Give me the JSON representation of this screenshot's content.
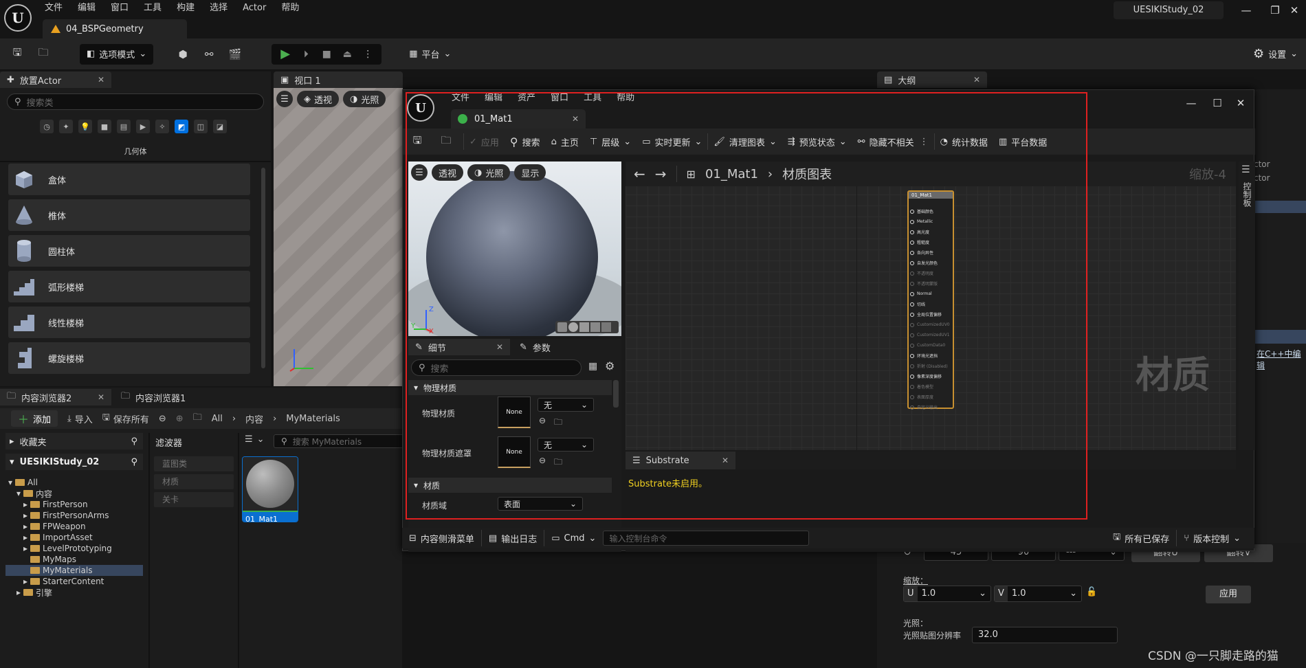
{
  "main_menu": [
    "文件",
    "编辑",
    "窗口",
    "工具",
    "构建",
    "选择",
    "Actor",
    "帮助"
  ],
  "level_tab": "04_BSPGeometry",
  "project_name": "UESIKIStudy_02",
  "toolbar": {
    "mode_label": "选项模式",
    "platform_label": "平台",
    "settings_label": "设置"
  },
  "place_actor": {
    "tab": "放置Actor",
    "search_placeholder": "搜索类",
    "category_label": "几何体",
    "items": [
      "盒体",
      "椎体",
      "圆柱体",
      "弧形楼梯",
      "线性楼梯",
      "螺旋楼梯"
    ]
  },
  "viewport": {
    "tab": "视口 1",
    "perspective": "透视",
    "lighting": "光照"
  },
  "outliner": {
    "tab": "大纲"
  },
  "content_browser": {
    "tab1": "内容浏览器2",
    "tab2": "内容浏览器1",
    "add": "添加",
    "import": "导入",
    "save_all": "保存所有",
    "breadcrumb": [
      "All",
      "内容",
      "MyMaterials"
    ],
    "favorites": "收藏夹",
    "project": "UESIKIStudy_02",
    "tree": [
      {
        "label": "All",
        "depth": 0
      },
      {
        "label": "内容",
        "depth": 1
      },
      {
        "label": "FirstPerson",
        "depth": 2
      },
      {
        "label": "FirstPersonArms",
        "depth": 2
      },
      {
        "label": "FPWeapon",
        "depth": 2
      },
      {
        "label": "ImportAsset",
        "depth": 2
      },
      {
        "label": "LevelPrototyping",
        "depth": 2
      },
      {
        "label": "MyMaps",
        "depth": 2
      },
      {
        "label": "MyMaterials",
        "depth": 2
      },
      {
        "label": "StarterContent",
        "depth": 2
      },
      {
        "label": "引擎",
        "depth": 1
      }
    ],
    "filters_title": "滤波器",
    "filters": [
      "蓝图类",
      "材质",
      "关卡"
    ],
    "search_placeholder": "搜索 MyMaterials",
    "asset": {
      "name": "01_Mat1",
      "type": "材质"
    }
  },
  "material_editor": {
    "menu": [
      "文件",
      "编辑",
      "资产",
      "窗口",
      "工具",
      "帮助"
    ],
    "tab": "01_Mat1",
    "toolbar": [
      "应用",
      "搜索",
      "主页",
      "层级",
      "实时更新",
      "清理图表",
      "预览状态",
      "隐藏不相关",
      "统计数据",
      "平台数据"
    ],
    "preview_buttons": [
      "透视",
      "光照",
      "显示"
    ],
    "graph": {
      "title": "01_Mat1",
      "crumb": "材质图表",
      "zoom": "缩放-4",
      "watermark": "材质",
      "side_tab": "控制板"
    },
    "node": {
      "title": "01_Mat1",
      "pins": [
        {
          "label": "基础颜色",
          "active": true
        },
        {
          "label": "Metallic",
          "active": true
        },
        {
          "label": "高光度",
          "active": true
        },
        {
          "label": "粗糙度",
          "active": true
        },
        {
          "label": "各向异性",
          "active": true
        },
        {
          "label": "自发光颜色",
          "active": true
        },
        {
          "label": "不透明度",
          "active": false
        },
        {
          "label": "不透明蒙版",
          "active": false
        },
        {
          "label": "Normal",
          "active": true
        },
        {
          "label": "切线",
          "active": true
        },
        {
          "label": "全局位置偏移",
          "active": true
        },
        {
          "label": "CustomizedUV0",
          "active": false
        },
        {
          "label": "CustomizedUV1",
          "active": false
        },
        {
          "label": "CustomData0",
          "active": false
        },
        {
          "label": "环境光遮挡",
          "active": true
        },
        {
          "label": "折射 (Disabled)",
          "active": false
        },
        {
          "label": "像素深度偏移",
          "active": true
        },
        {
          "label": "着色模型",
          "active": false
        },
        {
          "label": "表面厚度",
          "active": false
        },
        {
          "label": "自定义输出",
          "active": false
        }
      ]
    },
    "details": {
      "tab": "细节",
      "params_tab": "参数",
      "search_placeholder": "搜索",
      "section_physical": "物理材质",
      "physical_material": "物理材质",
      "physical_mask": "物理材质遮罩",
      "none": "None",
      "dropdown_none": "无",
      "section_material": "材质",
      "material_domain": "材质域",
      "material_domain_value": "表面"
    },
    "substrate": {
      "tab": "Substrate",
      "message": "Substrate未启用。"
    }
  },
  "statusbar": {
    "drawer": "内容侧滑菜单",
    "log": "输出日志",
    "cmd": "Cmd",
    "cmd_placeholder": "输入控制台命令",
    "saved": "所有已保存",
    "source_control": "版本控制"
  },
  "right_panel": {
    "rot1": "45",
    "rot2": "90",
    "rot3": "---",
    "flip_u": "翻转U",
    "flip_v": "翻转V",
    "scale_label": "缩放：",
    "u_label": "U",
    "u_value": "1.0",
    "v_label": "V",
    "v_value": "1.0",
    "apply": "应用",
    "lighting_label": "光照：",
    "lightmap_label": "光照贴图分辨率",
    "lightmap_value": "32.0",
    "cpp_link": "在C++中编辑",
    "actor1": "ctor",
    "actor2": "ctor"
  },
  "watermark": "CSDN @一只脚走路的猫",
  "colors": {
    "accent": "#0070e0",
    "highlight_red": "#e02020",
    "play_green": "#4caf50",
    "node_border": "#c89030"
  }
}
